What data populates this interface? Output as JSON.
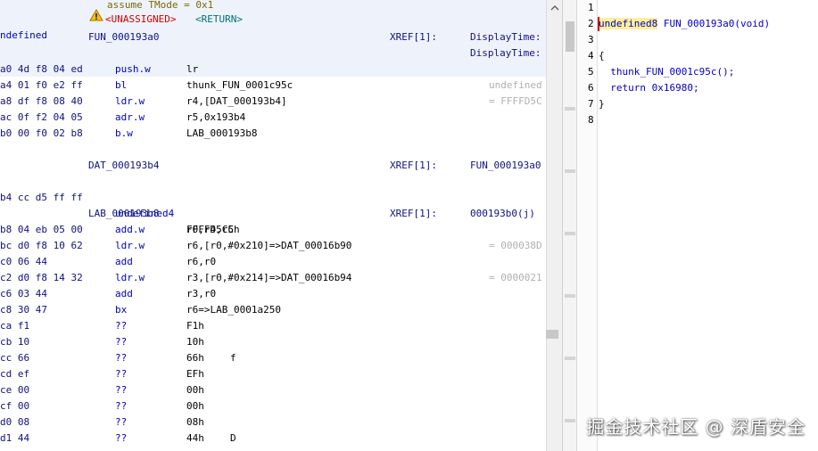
{
  "listing": {
    "header": {
      "left_label": "ndefined",
      "assume": "assume TMode = 0x1",
      "unassigned": "<UNASSIGNED>",
      "return_tag": "<RETURN>",
      "func_label": "FUN_000193a0",
      "xref": "XREF[1]:",
      "xref_target_1": "DisplayTime:",
      "xref_target_2": "DisplayTime:"
    },
    "instructions": [
      {
        "addr": "a0 4d f8 04 ed",
        "mnem": "push.w",
        "op": "lr",
        "cmt": ""
      },
      {
        "addr": "a4 01 f0 e2 ff",
        "mnem": "bl",
        "op": "thunk_FUN_0001c95c",
        "cmt": "undefined"
      },
      {
        "addr": "a8 df f8 08 40",
        "mnem": "ldr.w",
        "op": "r4,[DAT_000193b4]",
        "cmt": "= FFFFD5C"
      },
      {
        "addr": "ac 0f f2 04 05",
        "mnem": "adr.w",
        "op": "r5,0x193b4",
        "cmt": ""
      },
      {
        "addr": "b0 00 f0 02 b8",
        "mnem": "b.w",
        "op": "LAB_000193b8",
        "cmt": ""
      }
    ],
    "dat_block": {
      "label": "DAT_000193b4",
      "xref": "XREF[1]:",
      "xref_target": "FUN_000193a0",
      "addr": "b4 cc d5 ff ff",
      "mnem": "undefined4",
      "op": "FFFFD5CCh"
    },
    "lab_block": {
      "label": "LAB_000193b8",
      "xref": "XREF[1]:",
      "xref_target": "000193b0(j)",
      "rows": [
        {
          "addr": "b8 04 eb 05 00",
          "mnem": "add.w",
          "op": "r0,r4,r5",
          "cmt": "",
          "ch": ""
        },
        {
          "addr": "bc d0 f8 10 62",
          "mnem": "ldr.w",
          "op": "r6,[r0,#0x210]=>DAT_00016b90",
          "cmt": "= 000038D",
          "ch": ""
        },
        {
          "addr": "c0 06 44",
          "mnem": "add",
          "op": "r6,r0",
          "cmt": "",
          "ch": ""
        },
        {
          "addr": "c2 d0 f8 14 32",
          "mnem": "ldr.w",
          "op": "r3,[r0,#0x214]=>DAT_00016b94",
          "cmt": "= 0000021",
          "ch": ""
        },
        {
          "addr": "c6 03 44",
          "mnem": "add",
          "op": "r3,r0",
          "cmt": "",
          "ch": ""
        },
        {
          "addr": "c8 30 47",
          "mnem": "bx",
          "op": "r6=>LAB_0001a250",
          "cmt": "",
          "ch": ""
        },
        {
          "addr": "ca f1",
          "mnem": "??",
          "op": "F1h",
          "cmt": "",
          "ch": ""
        },
        {
          "addr": "cb 10",
          "mnem": "??",
          "op": "10h",
          "cmt": "",
          "ch": ""
        },
        {
          "addr": "cc 66",
          "mnem": "??",
          "op": "66h",
          "cmt": "",
          "ch": "f"
        },
        {
          "addr": "cd ef",
          "mnem": "??",
          "op": "EFh",
          "cmt": "",
          "ch": ""
        },
        {
          "addr": "ce 00",
          "mnem": "??",
          "op": "00h",
          "cmt": "",
          "ch": ""
        },
        {
          "addr": "cf 00",
          "mnem": "??",
          "op": "00h",
          "cmt": "",
          "ch": ""
        },
        {
          "addr": "d0 08",
          "mnem": "??",
          "op": "08h",
          "cmt": "",
          "ch": ""
        },
        {
          "addr": "d1 44",
          "mnem": "??",
          "op": "44h",
          "cmt": "",
          "ch": "D"
        }
      ]
    }
  },
  "decompiler": {
    "lines": [
      {
        "n": "1",
        "text": ""
      },
      {
        "n": "2",
        "type": "undefined8",
        "rest": " FUN_000193a0(void)"
      },
      {
        "n": "3",
        "text": ""
      },
      {
        "n": "4",
        "text": "{"
      },
      {
        "n": "5",
        "text": "  thunk_FUN_0001c95c();"
      },
      {
        "n": "6",
        "text": "  return 0x16980;"
      },
      {
        "n": "7",
        "text": "}"
      },
      {
        "n": "8",
        "text": ""
      }
    ]
  },
  "watermark": "掘金技术社区 @ 深盾安全",
  "colors": {
    "address": "#101080",
    "mnemonic": "#0000c0",
    "label": "#101080",
    "assume": "#7a6a00",
    "unassigned": "#cc0000",
    "return_tag": "#007070",
    "highlight": "#eef3fb",
    "cursor_token": "#ffef9a"
  }
}
